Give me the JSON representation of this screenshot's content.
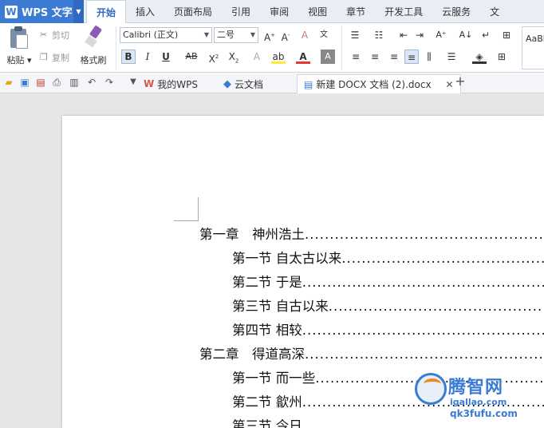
{
  "app": {
    "name": "WPS 文字",
    "logo": "W"
  },
  "tabs": [
    "开始",
    "插入",
    "页面布局",
    "引用",
    "审阅",
    "视图",
    "章节",
    "开发工具",
    "云服务",
    "文"
  ],
  "ribbon": {
    "paste_label": "粘贴",
    "cut_label": "剪切",
    "copy_label": "复制",
    "format_painter_label": "格式刷",
    "font_name": "Calibri (正文)",
    "font_size": "二号",
    "style_preview": "AaBb"
  },
  "doc_tabs": [
    {
      "label": "我的WPS",
      "badge": "W"
    },
    {
      "label": "云文档",
      "badge": "◆"
    },
    {
      "label": "新建 DOCX 文档 (2).docx",
      "badge": "▤"
    }
  ],
  "toc": {
    "items": [
      {
        "level": 1,
        "text": "第一章　神州浩土"
      },
      {
        "level": 2,
        "text": "第一节  自太古以来"
      },
      {
        "level": 2,
        "text": "第二节  于是"
      },
      {
        "level": 2,
        "text": "第三节  自古以来"
      },
      {
        "level": 2,
        "text": "第四节  相较"
      },
      {
        "level": 1,
        "text": "第二章　得道高深"
      },
      {
        "level": 2,
        "text": "第一节  而一些"
      },
      {
        "level": 2,
        "text": "第二节  歙州"
      },
      {
        "level": 2,
        "text": "第三节  今日"
      }
    ]
  },
  "watermark": {
    "title": "腾智网",
    "url": "igallao.com",
    "brand": "qk3fufu.com"
  },
  "colors": {
    "accent": "#3b7bd4",
    "brand_orange": "#f08a1b"
  }
}
